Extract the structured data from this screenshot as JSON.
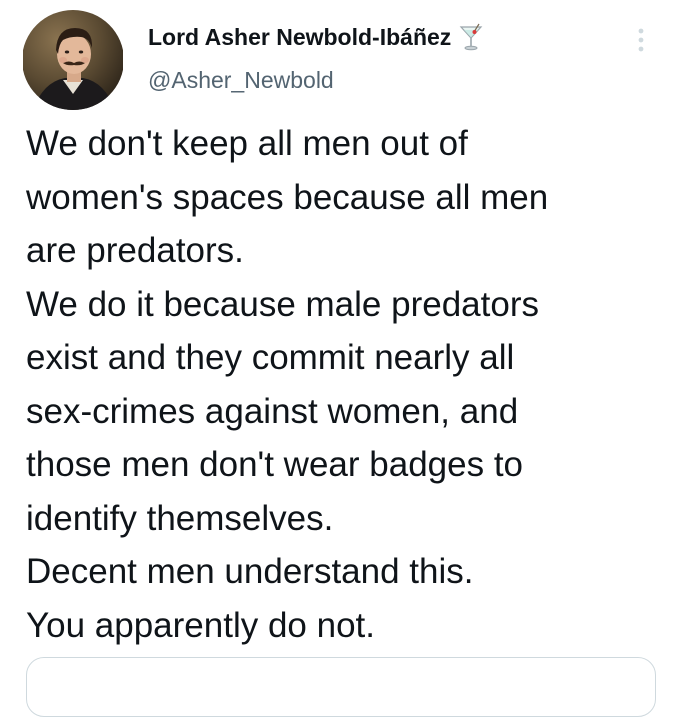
{
  "author": {
    "display_name": "Lord Asher Newbold-Ibáñez",
    "name_emoji_icon": "cocktail-glass-icon",
    "handle": "@Asher_Newbold",
    "avatar_icon": "profile-portrait-avatar"
  },
  "menu": {
    "icon": "more-vertical-icon"
  },
  "tweet": {
    "lines": [
      "We don't keep all men out of",
      "women's spaces because all men",
      "are predators.",
      "We do it because male predators",
      "exist and they commit nearly all",
      "sex-crimes against women, and",
      "those men don't wear badges to",
      "identify themselves.",
      "Decent men understand this.",
      "You apparently do not."
    ]
  },
  "colors": {
    "text": "#0f1419",
    "secondary": "#536471",
    "border": "#cfd9de",
    "background": "#ffffff"
  }
}
